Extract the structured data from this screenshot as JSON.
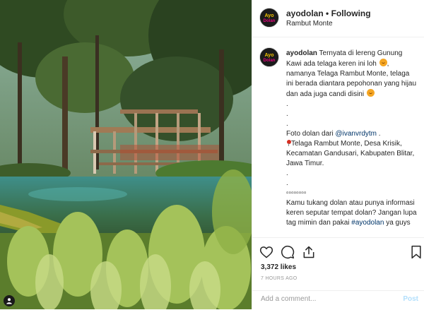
{
  "header": {
    "username": "ayodolan",
    "separator": "•",
    "follow_status": "Following",
    "location": "Rambut Monte"
  },
  "avatar": {
    "logo_text": "Ayo Dolan"
  },
  "caption": {
    "username": "ayodolan",
    "line1": "Ternyata di lereng Gunung Kawi ada telaga keren ini loh",
    "line2": ", namanya Telaga Rambut Monte, telaga ini berada diantara pepohonan yang hijau dan ada juga candi disini",
    "dot1": ".",
    "dot2": ".",
    "dot3": ".",
    "photo_credit_prefix": "Foto dolan dari",
    "mention": "@ivanvrdytm",
    "photo_credit_suffix": ".",
    "address": "Telaga Rambut Monte, Desa Krisik, Kecamatan Gandusari, Kabupaten Blitar, Jawa Timur.",
    "dot4": ".",
    "dot5": ".",
    "squares": "▫▫▫▫▫▫▫▫",
    "outro": "Kamu tukang dolan atau punya informasi keren seputar tempat dolan? Jangan lupa tag mimin dan pakai",
    "hashtag": "#ayodolan",
    "outro_end": "ya guys"
  },
  "actions": {
    "like_icon": "heart-icon",
    "comment_icon": "comment-icon",
    "share_icon": "share-icon",
    "save_icon": "bookmark-icon"
  },
  "likes": "3,372 likes",
  "timestamp": "7 HOURS AGO",
  "comment": {
    "placeholder": "Add a comment...",
    "post_label": "Post"
  },
  "colors": {
    "link": "#003569",
    "post_button_disabled": "#b2dffc",
    "meta_gray": "#999999",
    "avatar_bg": "#1b1b1b",
    "avatar_accent": "#e6007e"
  }
}
